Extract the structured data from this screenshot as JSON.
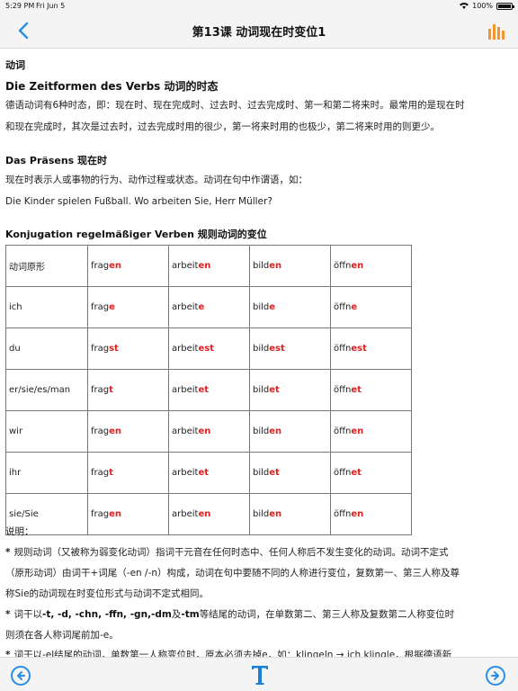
{
  "status": {
    "time": "5:29 PM",
    "date": "Fri Jun 5",
    "battery": "100%",
    "battery_level": 1.0
  },
  "nav": {
    "title": "第13课 动词现在时变位1",
    "back_icon": "chevron-left-icon",
    "chart_icon": "bar-chart-icon"
  },
  "content": {
    "section_label": "动词",
    "heading1": "Die Zeitformen des Verbs 动词的时态",
    "para1_line1": "德语动词有6种时态，即：现在时、现在完成时、过去时、过去完成时、第一和第二将来时。最常用的是现在时",
    "para1_line2": "和现在完成时，其次是过去时，过去完成时用的很少，第一将来时用的也极少，第二将来时用的则更少。",
    "heading2": "Das Präsens 现在时",
    "para2_line1": "现在时表示人或事物的行为、动作过程或状态。动词在句中作谓语，如：",
    "para2_line2": "Die Kinder spielen Fußball. Wo arbeiten Sie, Herr Müller?",
    "heading3": "Konjugation regelmäßiger Verben  规则动词的变位"
  },
  "table": {
    "rows": [
      [
        {
          "s": "动词原形",
          "e": ""
        },
        {
          "s": "frag",
          "e": "en"
        },
        {
          "s": "arbeit",
          "e": "en"
        },
        {
          "s": "bild",
          "e": "en"
        },
        {
          "s": "öffn",
          "e": "en"
        }
      ],
      [
        {
          "s": "ich",
          "e": ""
        },
        {
          "s": "frag",
          "e": "e"
        },
        {
          "s": "arbeit",
          "e": "e"
        },
        {
          "s": "bild",
          "e": "e"
        },
        {
          "s": "öffn",
          "e": "e"
        }
      ],
      [
        {
          "s": "du",
          "e": ""
        },
        {
          "s": "frag",
          "e": "st"
        },
        {
          "s": "arbeit",
          "e": "est"
        },
        {
          "s": "bild",
          "e": "est"
        },
        {
          "s": "öffn",
          "e": "est"
        }
      ],
      [
        {
          "s": "er/sie/es/man",
          "e": ""
        },
        {
          "s": "frag",
          "e": "t"
        },
        {
          "s": "arbeit",
          "e": "et"
        },
        {
          "s": "bild",
          "e": "et"
        },
        {
          "s": "öffn",
          "e": "et"
        }
      ],
      [
        {
          "s": "wir",
          "e": ""
        },
        {
          "s": "frag",
          "e": "en"
        },
        {
          "s": "arbeit",
          "e": "en"
        },
        {
          "s": "bild",
          "e": "en"
        },
        {
          "s": "öffn",
          "e": "en"
        }
      ],
      [
        {
          "s": "ihr",
          "e": ""
        },
        {
          "s": "frag",
          "e": "t"
        },
        {
          "s": "arbeit",
          "e": "et"
        },
        {
          "s": "bild",
          "e": "et"
        },
        {
          "s": "öffn",
          "e": "et"
        }
      ],
      [
        {
          "s": "sie/Sie",
          "e": ""
        },
        {
          "s": "frag",
          "e": "en"
        },
        {
          "s": "arbeit",
          "e": "en"
        },
        {
          "s": "bild",
          "e": "en"
        },
        {
          "s": "öffn",
          "e": "en"
        }
      ]
    ],
    "ending_color": "#e02020"
  },
  "notes": {
    "label": "说明：",
    "star": "*",
    "note1_line1": "规则动词（又被称为弱变化动词）指词干元音在任何时态中、任何人称后不发生变化的动词。动词不定式",
    "note1_line2": "（原形动词）由词干+词尾（-en /-n）构成，动词在句中要随不同的人称进行变位，复数第一、第三人称及尊",
    "note1_line3": "称Sie的动词现在时变位形式与动词不定式相同。",
    "note2_pre": "词干以",
    "note2_bold": "-t, -d, -chn, -ffn, -gn,-dm",
    "note2_mid": "及",
    "note2_bold2": "-tm",
    "note2_post": "等结尾的动词，在单数第二、第三人称及复数第二人称变位时",
    "note2_line2": "则须在各人称词尾前加-e。",
    "note3_partial": "词干以-el结尾的动词，单数第一人称变位时，原本必须去掉e，如：klingeln → ich klingle，根据德语新"
  },
  "bottom": {
    "prev_icon": "arrow-left-circle-icon",
    "font_label": "T",
    "next_icon": "arrow-right-circle-icon"
  },
  "colors": {
    "accent": "#2a8ee6",
    "chart_icon": "#f0962a",
    "font_icon": "#1e7fd6",
    "bar_bg": "#f4f4f4"
  }
}
